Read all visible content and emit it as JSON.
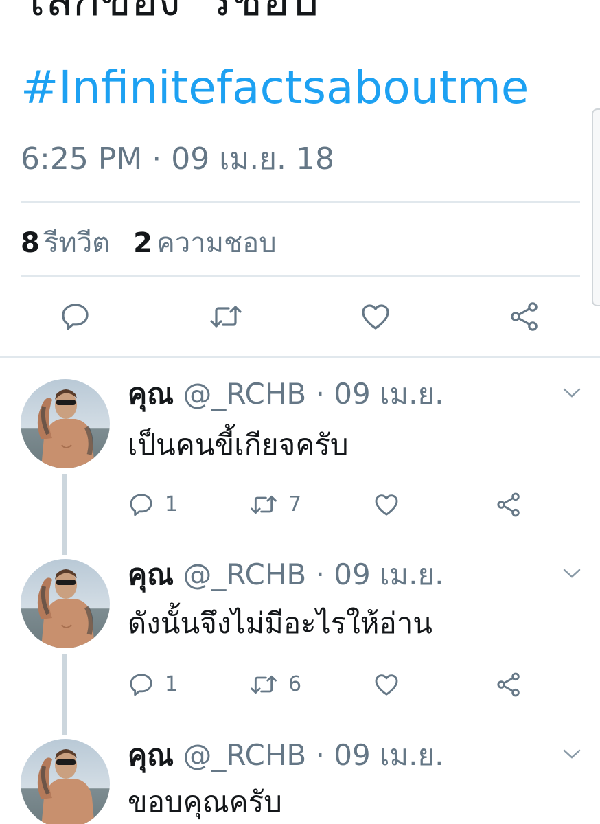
{
  "tweet": {
    "text_line": "โลกของ 'รชฮบ'",
    "hashtag": "#Infinitefactsaboutme",
    "timestamp": "6:25 PM · 09 เม.ย. 18",
    "retweet_count": "8",
    "retweet_label": "รีทวีต",
    "like_count": "2",
    "like_label": "ความชอบ"
  },
  "actions": {
    "reply_icon": "reply-icon",
    "retweet_icon": "retweet-icon",
    "like_icon": "heart-icon",
    "share_icon": "share-icon"
  },
  "replies": [
    {
      "name": "คุณ",
      "meta": "@_RCHB · 09 เม.ย.",
      "text": "เป็นคนขี้เกียจครับ",
      "reply_count": "1",
      "retweet_count": "7",
      "like_count": ""
    },
    {
      "name": "คุณ",
      "meta": "@_RCHB · 09 เม.ย.",
      "text": "ดังนั้นจึงไม่มีอะไรให้อ่าน",
      "reply_count": "1",
      "retweet_count": "6",
      "like_count": ""
    },
    {
      "name": "คุณ",
      "meta": "@_RCHB · 09 เม.ย.",
      "text": "ขอบคุณครับ"
    }
  ],
  "colors": {
    "accent": "#1da1f2",
    "secondary_text": "#657786",
    "divider": "#e1e8ed",
    "thread_line": "#ccd6dd"
  }
}
